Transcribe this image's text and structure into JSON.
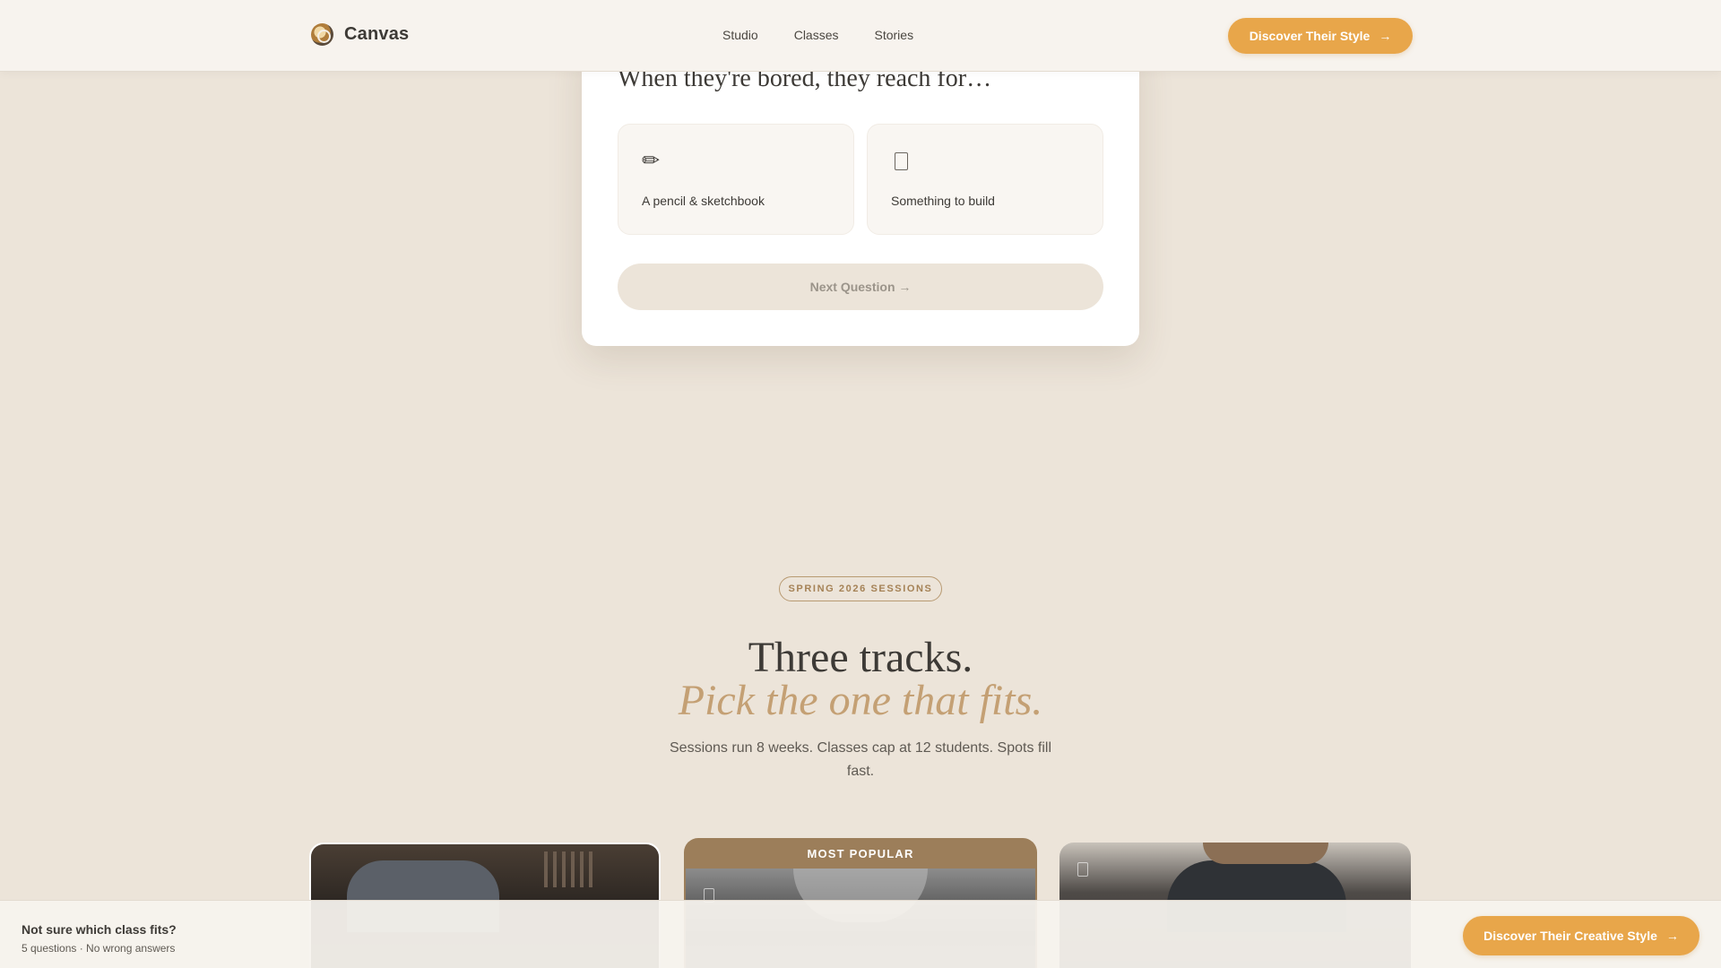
{
  "header": {
    "logo_text": "Canvas",
    "nav": [
      "Studio",
      "Classes",
      "Stories"
    ],
    "cta_label": "Discover Their Style",
    "cta_arrow": "→"
  },
  "quiz": {
    "question": "When they're bored, they reach for…",
    "options": [
      {
        "icon": "✏",
        "icon_name": "pencil-icon",
        "label": "A pencil & sketchbook"
      },
      {
        "icon_name": "build-icon",
        "label": "Something to build"
      }
    ],
    "next_label": "Next Question →"
  },
  "section": {
    "eyebrow": "SPRING 2026 SESSIONS",
    "title": "Three tracks.",
    "subtitle": "Pick the one that fits.",
    "description": "Sessions run 8 weeks. Classes cap at 12 students. Spots fill fast."
  },
  "tracks": {
    "popular_badge": "MOST POPULAR"
  },
  "bottom_bar": {
    "title": "Not sure which class fits?",
    "subtitle": "5 questions · No wrong answers",
    "cta_label": "Discover Their Creative Style",
    "cta_arrow": "→"
  },
  "colors": {
    "accent": "#e8a64a",
    "background": "#ece4d9",
    "gold_text": "#c4a074",
    "badge_bg": "#9c7e5a"
  }
}
